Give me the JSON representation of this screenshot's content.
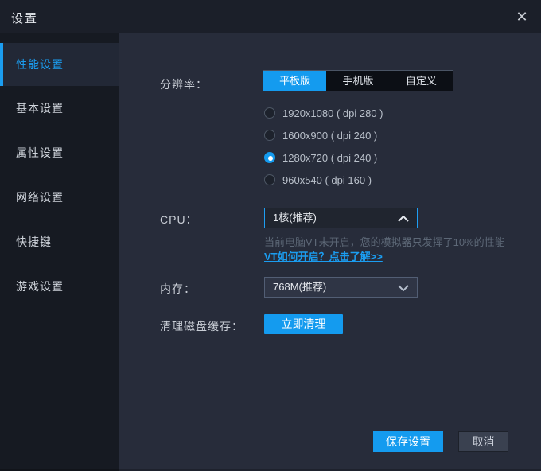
{
  "window": {
    "title": "设置"
  },
  "colors": {
    "accent_blue": "#149bef",
    "link_blue": "#1b9df0",
    "titlebar_bg": "#1b1f29",
    "sidebar_bg": "#161a22",
    "content_bg": "#272c3a",
    "warning_text": "#5d6877"
  },
  "icons": {
    "close": "✕",
    "chevron_up": "chevron-up",
    "chevron_down": "chevron-down"
  },
  "sidebar": {
    "items": [
      {
        "label": "性能设置",
        "selected": true
      },
      {
        "label": "基本设置",
        "selected": false
      },
      {
        "label": "属性设置",
        "selected": false
      },
      {
        "label": "网络设置",
        "selected": false
      },
      {
        "label": "快捷键",
        "selected": false
      },
      {
        "label": "游戏设置",
        "selected": false
      }
    ]
  },
  "content": {
    "resolution": {
      "label": "分辨率：",
      "tabs": [
        {
          "label": "平板版",
          "selected": true
        },
        {
          "label": "手机版",
          "selected": false
        },
        {
          "label": "自定义",
          "selected": false
        }
      ],
      "options": [
        {
          "label": "1920x1080 ( dpi 280 )",
          "selected": false
        },
        {
          "label": "1600x900 ( dpi 240 )",
          "selected": false
        },
        {
          "label": "1280x720 ( dpi 240 )",
          "selected": true
        },
        {
          "label": "960x540 ( dpi 160 )",
          "selected": false
        }
      ]
    },
    "cpu": {
      "label": "CPU：",
      "value": "1核(推荐)",
      "warning": "当前电脑VT未开启，您的模拟器只发挥了10%的性能",
      "link": "VT如何开启？点击了解>>"
    },
    "memory": {
      "label": "内存：",
      "value": "768M(推荐)"
    },
    "cache": {
      "label": "清理磁盘缓存：",
      "button": "立即清理"
    },
    "footer": {
      "save": "保存设置",
      "cancel": "取消"
    }
  }
}
